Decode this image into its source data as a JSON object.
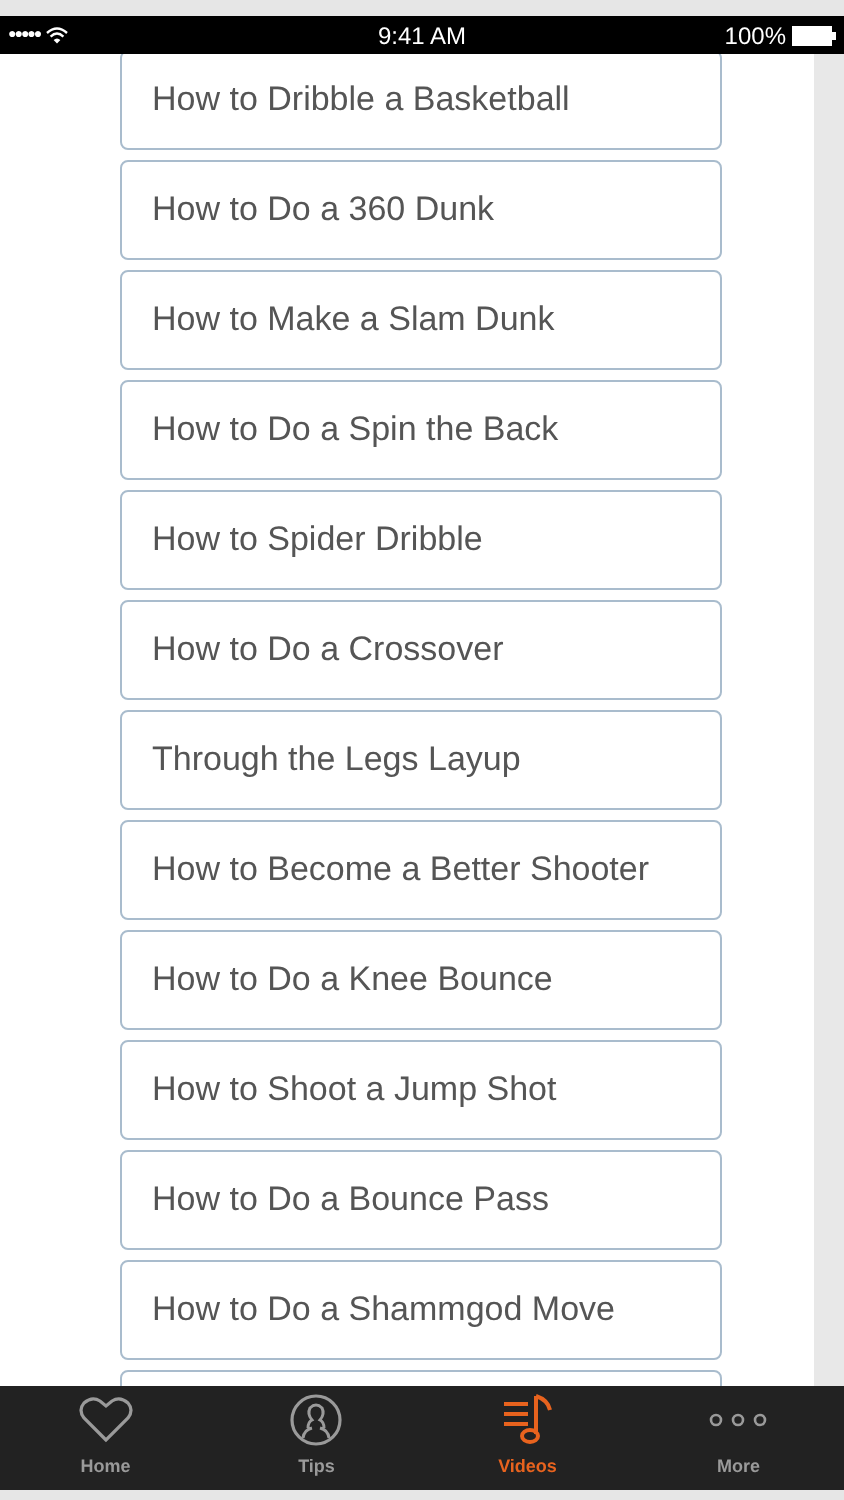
{
  "status_bar": {
    "signal": "●●●●●",
    "time": "9:41 AM",
    "battery": "100%"
  },
  "videos": [
    {
      "title": "How to Dribble a Basketball"
    },
    {
      "title": "How to Do a 360 Dunk"
    },
    {
      "title": "How to Make a Slam Dunk"
    },
    {
      "title": "How to Do a Spin the Back"
    },
    {
      "title": "How to Spider Dribble"
    },
    {
      "title": "How to Do a Crossover"
    },
    {
      "title": "Through the Legs Layup"
    },
    {
      "title": "How to Become a Better Shooter"
    },
    {
      "title": "How to Do a Knee Bounce"
    },
    {
      "title": "How to Shoot a Jump Shot"
    },
    {
      "title": "How to Do a Bounce Pass"
    },
    {
      "title": "How to Do a Shammgod Move"
    }
  ],
  "tab_bar": [
    {
      "label": "Home",
      "kind": "heart",
      "selected": false
    },
    {
      "label": "Tips",
      "kind": "person",
      "selected": false
    },
    {
      "label": "Videos",
      "kind": "music",
      "selected": true
    },
    {
      "label": "More",
      "kind": "dots",
      "selected": false
    }
  ]
}
